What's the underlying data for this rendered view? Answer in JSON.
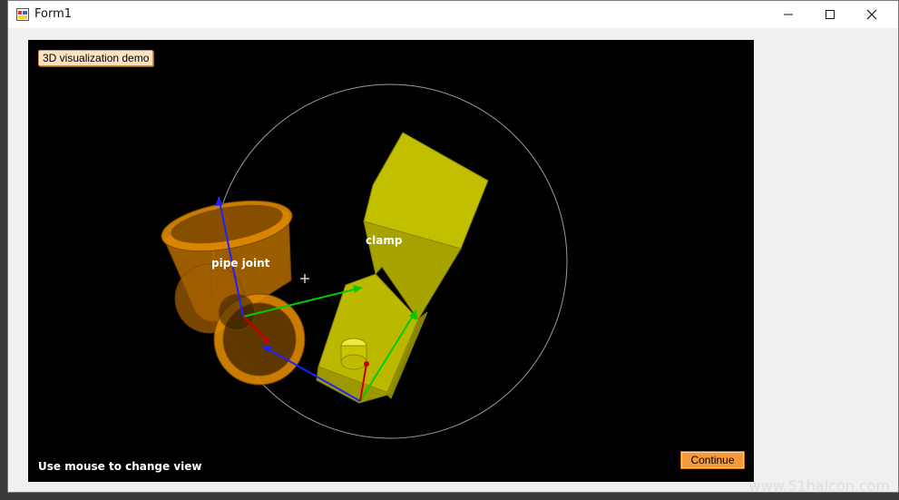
{
  "window": {
    "title": "Form1",
    "minimize_icon": "minimize-icon",
    "maximize_icon": "maximize-icon",
    "close_icon": "close-icon"
  },
  "viewport": {
    "demo_label": "3D visualization demo",
    "objects": {
      "pipe_joint": "pipe joint",
      "clamp": "clamp"
    },
    "hint": "Use mouse to change view",
    "continue_label": "Continue"
  },
  "colors": {
    "pipe": "#e08a00",
    "clamp": "#e4e000",
    "axis_x": "#c00000",
    "axis_y": "#00cc00",
    "axis_z": "#2020ff",
    "button": "#f59a38"
  },
  "watermark": "www.51halcon.com"
}
